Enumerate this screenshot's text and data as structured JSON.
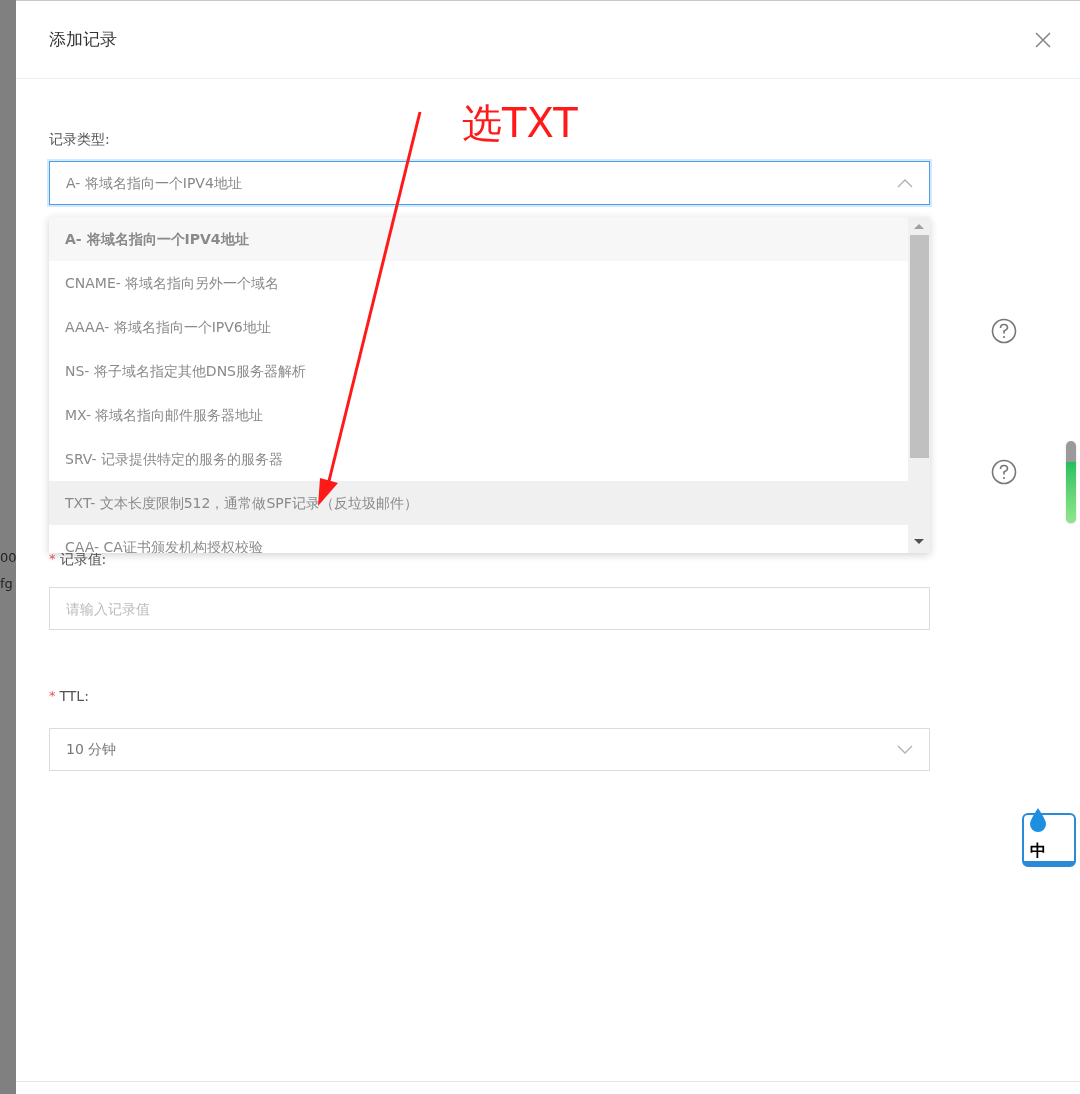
{
  "backdrop": {
    "texts": [
      "00",
      "fg"
    ]
  },
  "dialog": {
    "title": "添加记录",
    "record_type": {
      "label": "记录类型:",
      "value": "A- 将域名指向一个IPV4地址",
      "expanded": true,
      "options": [
        {
          "label": "A- 将域名指向一个IPV4地址",
          "selected": true,
          "hovered": false
        },
        {
          "label": "CNAME- 将域名指向另外一个域名",
          "selected": false,
          "hovered": false
        },
        {
          "label": "AAAA- 将域名指向一个IPV6地址",
          "selected": false,
          "hovered": false
        },
        {
          "label": "NS- 将子域名指定其他DNS服务器解析",
          "selected": false,
          "hovered": false
        },
        {
          "label": "MX- 将域名指向邮件服务器地址",
          "selected": false,
          "hovered": false
        },
        {
          "label": "SRV- 记录提供特定的服务的服务器",
          "selected": false,
          "hovered": false
        },
        {
          "label": "TXT- 文本长度限制512，通常做SPF记录（反垃圾邮件）",
          "selected": false,
          "hovered": true
        },
        {
          "label": "CAA- CA证书颁发机构授权校验",
          "selected": false,
          "hovered": false
        }
      ]
    },
    "record_value": {
      "required_mark": "*",
      "label": "记录值:",
      "placeholder": "请输入记录值"
    },
    "ttl": {
      "required_mark": "*",
      "label": "TTL:",
      "value": "10 分钟",
      "expanded": false
    }
  },
  "annotation": {
    "text": "选TXT"
  },
  "meter": {
    "level": 0.75
  },
  "ime": {
    "label": "中"
  }
}
